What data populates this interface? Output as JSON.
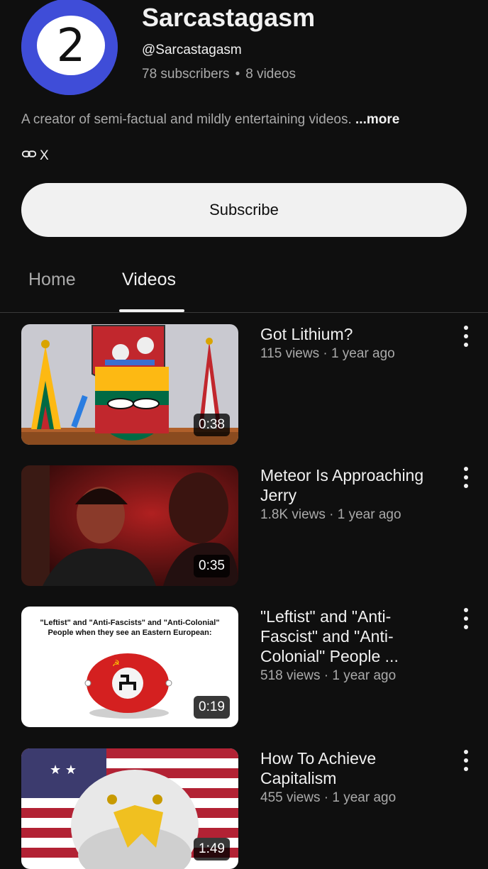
{
  "channel": {
    "avatar_text": "2",
    "name": "Sarcastagasm",
    "handle": "@Sarcastagasm",
    "subscribers": "78 subscribers",
    "separator": "•",
    "videos_count": "8 videos",
    "description": "A creator of semi-factual and mildly entertaining videos.",
    "more_label": "...more",
    "link_label": "X",
    "subscribe_label": "Subscribe"
  },
  "tabs": [
    {
      "label": "Home",
      "active": false
    },
    {
      "label": "Videos",
      "active": true
    }
  ],
  "videos": [
    {
      "title": "Got Lithium?",
      "meta": "115 views · 1 year ago",
      "duration": "0:38"
    },
    {
      "title": "Meteor Is Approaching Jerry",
      "meta": "1.8K views · 1 year ago",
      "duration": "0:35"
    },
    {
      "title": "\"Leftist\" and \"Anti-Fascist\" and \"Anti-Colonial\" People ...",
      "meta": "518 views · 1 year ago",
      "duration": "0:19",
      "thumb_text": "\"Leftist\" and \"Anti-Fascists\" and \"Anti-Colonial\" People when they see an Eastern European:"
    },
    {
      "title": "How To Achieve Capitalism",
      "meta": "455 views · 1 year ago",
      "duration": "1:49"
    }
  ],
  "colors": {
    "background": "#0f0f0f",
    "avatar_bg": "#3f4dd8",
    "subscribe_bg": "#f1f1f1",
    "secondary_text": "#aaaaaa"
  },
  "icons": [
    "link-icon",
    "more-vert-icon"
  ]
}
